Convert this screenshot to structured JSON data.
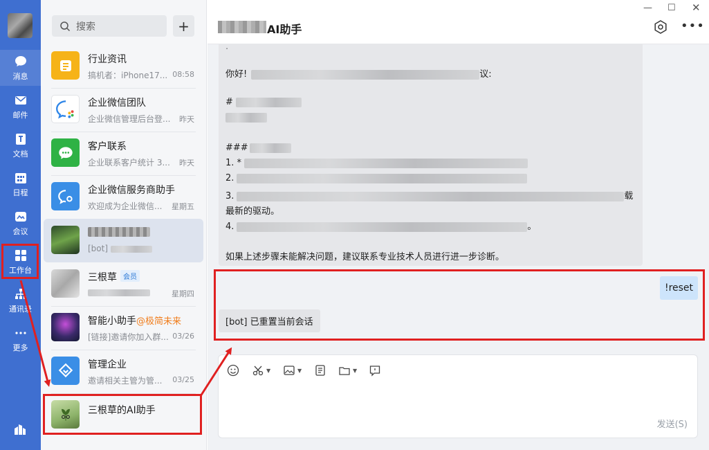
{
  "rail": {
    "items": [
      {
        "label": "消息",
        "icon": "chat-bubble-icon"
      },
      {
        "label": "邮件",
        "icon": "mail-icon"
      },
      {
        "label": "文档",
        "icon": "document-icon"
      },
      {
        "label": "日程",
        "icon": "calendar-icon"
      },
      {
        "label": "会议",
        "icon": "meeting-icon"
      },
      {
        "label": "工作台",
        "icon": "grid-icon"
      },
      {
        "label": "通讯录",
        "icon": "org-chart-icon"
      },
      {
        "label": "更多",
        "icon": "more-dots-icon"
      }
    ]
  },
  "search": {
    "placeholder": "搜索"
  },
  "conversations": [
    {
      "name": "行业资讯",
      "preview": "搞机者：iPhone17...",
      "time": "08:58"
    },
    {
      "name": "企业微信团队",
      "preview": "企业微信管理后台登...",
      "time": "昨天"
    },
    {
      "name": "客户联系",
      "preview": "企业联系客户统计 3....",
      "time": "昨天"
    },
    {
      "name": "企业微信服务商助手",
      "preview": "欢迎成为企业微信...",
      "time": "星期五"
    },
    {
      "name": "",
      "preview": "[bot]",
      "time": ""
    },
    {
      "name": "三根草",
      "badge": "会员",
      "preview": "",
      "time": "星期四"
    },
    {
      "name": "智能小助手",
      "tag": "@极简未来",
      "preview": "[链接]邀请你加入群...",
      "time": "03/26"
    },
    {
      "name": "管理企业",
      "preview": "邀请相关主管为管...",
      "time": "03/25"
    },
    {
      "name": "三根草的AI助手",
      "preview": "",
      "time": ""
    }
  ],
  "chat": {
    "title": "AI助手",
    "bot_message": {
      "greeting": "你好!",
      "greeting_tail": "议:",
      "heading1": "#",
      "heading2": "###",
      "item1": "1. *",
      "item2": "2.",
      "item3": "3.",
      "item3_tail": "载",
      "item3_cont": "最新的驱动。",
      "item4": "4.",
      "item4_tail": "。",
      "closing": "如果上述步骤未能解决问题，建议联系专业技术人员进行进一步诊断。"
    },
    "user_message": "!reset",
    "bot_reply": "[bot] 已重置当前会话",
    "send_label": "发送(S)"
  },
  "colors": {
    "rail": "#3f6fd0",
    "annotation": "#e02020",
    "user_bubble": "#cde4fb"
  }
}
